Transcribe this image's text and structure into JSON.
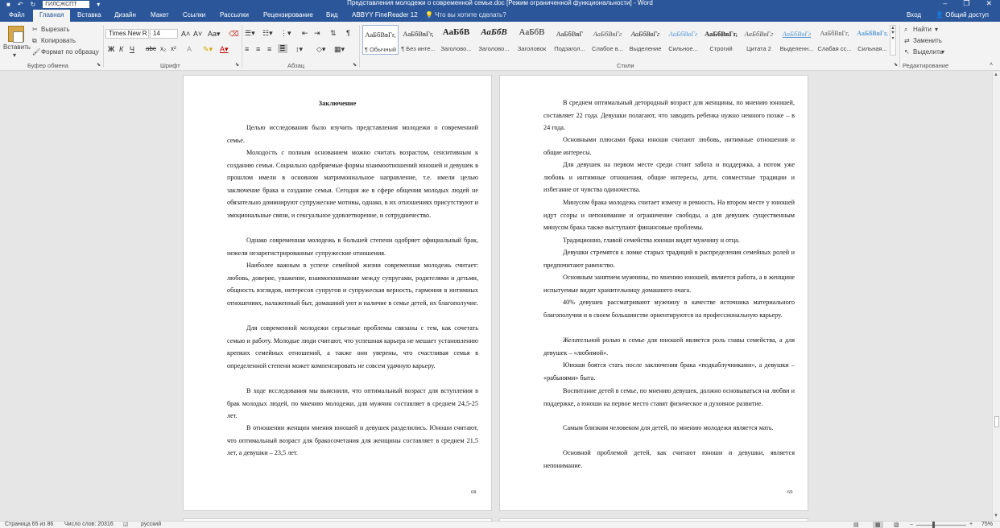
{
  "app": {
    "title": "Представления молодежи о современной семье.doc [Режим ограниченной функциональности] - Word",
    "qat_input": "ГИЛСЖСПТ"
  },
  "tabs": [
    "Файл",
    "Главная",
    "Вставка",
    "Дизайн",
    "Макет",
    "Ссылки",
    "Рассылки",
    "Рецензирование",
    "Вид",
    "ABBYY FineReader 12"
  ],
  "tell_me": "Что вы хотите сделать?",
  "account": {
    "signin": "Вход",
    "share": "Общий доступ"
  },
  "ribbon": {
    "clipboard": {
      "paste": "Вставить",
      "cut": "Вырезать",
      "copy": "Копировать",
      "format_painter": "Формат по образцу",
      "label": "Буфер обмена"
    },
    "font": {
      "name": "Times New R",
      "size": "14",
      "label": "Шрифт"
    },
    "paragraph": {
      "label": "Абзац"
    },
    "styles": {
      "label": "Стили",
      "items": [
        {
          "preview": "АаБбВвГг,",
          "name": "¶ Обычный"
        },
        {
          "preview": "АаБбВвГг,",
          "name": "¶ Без инте..."
        },
        {
          "preview": "АаБбВ",
          "name": "Заголово..."
        },
        {
          "preview": "АаБбВ",
          "name": "Заголово..."
        },
        {
          "preview": "АаБбВ",
          "name": "Заголовок"
        },
        {
          "preview": "АаБбВвГ",
          "name": "Подзагол..."
        },
        {
          "preview": "АаБбВвГг",
          "name": "Слабое в..."
        },
        {
          "preview": "АаБбВвГг",
          "name": "Выделение"
        },
        {
          "preview": "АаБбВвГг",
          "name": "Сильное..."
        },
        {
          "preview": "АаБбВвГг,",
          "name": "Строгий"
        },
        {
          "preview": "АаБбВвГг",
          "name": "Цитата 2"
        },
        {
          "preview": "АаБбВвГг",
          "name": "Выделенн..."
        },
        {
          "preview": "АаБбВвГг,",
          "name": "Слабая сс..."
        },
        {
          "preview": "АаБбВвГг,",
          "name": "Сильная..."
        }
      ]
    },
    "editing": {
      "find": "Найти",
      "replace": "Заменить",
      "select": "Выделить",
      "label": "Редактирование"
    }
  },
  "pages": [
    {
      "title": "Заключение",
      "number": "68",
      "paragraphs": [
        "Целью исследования было изучить представления молодежи о современной семье.",
        "Молодость с полным основанием можно считать возрастом, сенситивным к созданию семьи. Социально одобряемые формы взаимоотношений юношей и девушек в прошлом имели в основном матримониальное направление, т.е. имели целью заключение брака и создание семьи. Сегодня же в сфере общения молодых людей не обязательно доминируют супружеские мотивы, однако, в их отношениях присутствуют и эмоциональные связи, и сексуальное удовлетворение, и сотрудничество.",
        "Однако современная молодежь в большей степени одобряет официальный брак, нежели незарегистрированные супружеские отношения.",
        "Наиболее важным в успехе семейной жизни современная молодежь считает: любовь, доверие, уважение, взаимопонимание между супругами, родителями и детьми, общность взглядов, интересов супругов и супружеская верность, гармония в интимных отношениях, налаженный быт, домашний уют и наличие в семье детей, их благополучие.",
        "Для современной молодежи серьезные проблемы связаны с тем, как сочетать семью и работу. Молодые люди считают, что успешная карьера не мешает установлению крепких семейных отношений, а также они уверены, что счастливая семья в определенной степени может компенсировать не совсем удачную карьеру.",
        "В ходе исследования мы выяснили, что оптимальный возраст для вступления в брак молодых людей, по мнению молодежи, для мужчин составляет в среднем 24,5-25 лет.",
        "В отношении женщин мнения юношей и девушек разделились. Юноши считают, что оптимальный возраст для бракосочетания для женщины составляет в среднем 21,5 лет, а девушки – 23,5 лет."
      ]
    },
    {
      "number": "69",
      "paragraphs": [
        "В среднем оптимальный детородный возраст для женщины, по мнению юношей, составляет 22 года. Девушки полагают, что заводить ребенка нужно немного позже – в 24 года.",
        "Основными плюсами брака юноши считают любовь, интимные отношения и общие интересы.",
        "Для девушек на первом месте среди стоит забота и поддержка, а потом уже любовь и интимные отношения, общие интересы, дети, совместные традиции и избегание от чувства одиночества.",
        "Минусом брака молодежь считает измену и ревность. На втором месте у юношей идут ссоры и непонимание и ограничение свободы, а для девушек существенным минусом брака также выступают финансовые проблемы.",
        "Традиционно, главой семейства юноши видят мужчину и отца.",
        "Девушки стремятся к ломке старых традиций в распределения семейных ролей и предпочитают равенство.",
        "Основным занятием мужчины, по мнению юношей, является работа, а в женщине испытуемые видят хранительницу домашнего очага.",
        "40% девушек рассматривают мужчину в качестве источника материального благополучия и в своем большинстве ориентируются на профессиональную карьеру.",
        "Желательной ролью в семье для юношей является роль главы семейства, а для девушек – «любимой».",
        "Юноши боятся стать после заключения брака «подкаблучниками», а девушки – «рабынями» быта.",
        "Воспитание детей в семье, по мнению девушек, должно основываться на любви и поддержке, а юноши на первое место ставят физическое и духовное развитие.",
        "Самым близким человеком для детей, по мнению молодежи является мать.",
        "Основной проблемой детей, как считают юноши и девушки, является непонимание."
      ]
    }
  ],
  "status": {
    "page": "Страница 65 из 86",
    "words": "Число слов: 20316",
    "language": "русский",
    "zoom": "75%"
  }
}
